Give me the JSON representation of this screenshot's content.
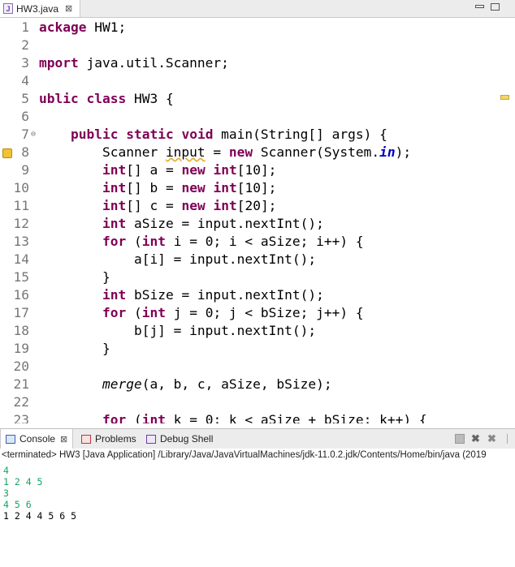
{
  "editor_tab": {
    "title": "HW3.java",
    "close": "⊠"
  },
  "code_lines": [
    {
      "n": "1",
      "tokens": [
        {
          "t": "ackage",
          "c": "kw"
        },
        {
          "t": " HW1;",
          "c": ""
        }
      ]
    },
    {
      "n": "2",
      "tokens": []
    },
    {
      "n": "3",
      "tokens": [
        {
          "t": "mport",
          "c": "kw"
        },
        {
          "t": " java.util.Scanner;",
          "c": ""
        }
      ]
    },
    {
      "n": "4",
      "tokens": []
    },
    {
      "n": "5",
      "tokens": [
        {
          "t": "ublic",
          "c": "kw"
        },
        {
          "t": " ",
          "c": ""
        },
        {
          "t": "class",
          "c": "kw"
        },
        {
          "t": " HW3 {",
          "c": ""
        }
      ]
    },
    {
      "n": "6",
      "tokens": []
    },
    {
      "n": "7",
      "fold": true,
      "tokens": [
        {
          "t": "    ",
          "c": ""
        },
        {
          "t": "public",
          "c": "kw"
        },
        {
          "t": " ",
          "c": ""
        },
        {
          "t": "static",
          "c": "kw"
        },
        {
          "t": " ",
          "c": ""
        },
        {
          "t": "void",
          "c": "kw"
        },
        {
          "t": " main(String[] args) {",
          "c": ""
        }
      ]
    },
    {
      "n": "8",
      "marker": true,
      "tokens": [
        {
          "t": "        Scanner ",
          "c": ""
        },
        {
          "t": "input",
          "c": "warn"
        },
        {
          "t": " = ",
          "c": ""
        },
        {
          "t": "new",
          "c": "kw"
        },
        {
          "t": " Scanner(System.",
          "c": ""
        },
        {
          "t": "in",
          "c": "st"
        },
        {
          "t": ");",
          "c": ""
        }
      ]
    },
    {
      "n": "9",
      "tokens": [
        {
          "t": "        ",
          "c": ""
        },
        {
          "t": "int",
          "c": "kw"
        },
        {
          "t": "[] a = ",
          "c": ""
        },
        {
          "t": "new",
          "c": "kw"
        },
        {
          "t": " ",
          "c": ""
        },
        {
          "t": "int",
          "c": "kw"
        },
        {
          "t": "[10];",
          "c": ""
        }
      ]
    },
    {
      "n": "10",
      "tokens": [
        {
          "t": "        ",
          "c": ""
        },
        {
          "t": "int",
          "c": "kw"
        },
        {
          "t": "[] b = ",
          "c": ""
        },
        {
          "t": "new",
          "c": "kw"
        },
        {
          "t": " ",
          "c": ""
        },
        {
          "t": "int",
          "c": "kw"
        },
        {
          "t": "[10];",
          "c": ""
        }
      ]
    },
    {
      "n": "11",
      "tokens": [
        {
          "t": "        ",
          "c": ""
        },
        {
          "t": "int",
          "c": "kw"
        },
        {
          "t": "[] c = ",
          "c": ""
        },
        {
          "t": "new",
          "c": "kw"
        },
        {
          "t": " ",
          "c": ""
        },
        {
          "t": "int",
          "c": "kw"
        },
        {
          "t": "[20];",
          "c": ""
        }
      ]
    },
    {
      "n": "12",
      "tokens": [
        {
          "t": "        ",
          "c": ""
        },
        {
          "t": "int",
          "c": "kw"
        },
        {
          "t": " aSize = input.nextInt();",
          "c": ""
        }
      ]
    },
    {
      "n": "13",
      "tokens": [
        {
          "t": "        ",
          "c": ""
        },
        {
          "t": "for",
          "c": "kw"
        },
        {
          "t": " (",
          "c": ""
        },
        {
          "t": "int",
          "c": "kw"
        },
        {
          "t": " i = 0; i < aSize; i++) {",
          "c": ""
        }
      ]
    },
    {
      "n": "14",
      "tokens": [
        {
          "t": "            a[i] = input.nextInt();",
          "c": ""
        }
      ]
    },
    {
      "n": "15",
      "tokens": [
        {
          "t": "        }",
          "c": ""
        }
      ]
    },
    {
      "n": "16",
      "tokens": [
        {
          "t": "        ",
          "c": ""
        },
        {
          "t": "int",
          "c": "kw"
        },
        {
          "t": " bSize = input.nextInt();",
          "c": ""
        }
      ]
    },
    {
      "n": "17",
      "tokens": [
        {
          "t": "        ",
          "c": ""
        },
        {
          "t": "for",
          "c": "kw"
        },
        {
          "t": " (",
          "c": ""
        },
        {
          "t": "int",
          "c": "kw"
        },
        {
          "t": " j = 0; j < bSize; j++) {",
          "c": ""
        }
      ]
    },
    {
      "n": "18",
      "tokens": [
        {
          "t": "            b[j] = input.nextInt();",
          "c": ""
        }
      ]
    },
    {
      "n": "19",
      "tokens": [
        {
          "t": "        }",
          "c": ""
        }
      ]
    },
    {
      "n": "20",
      "tokens": []
    },
    {
      "n": "21",
      "tokens": [
        {
          "t": "        ",
          "c": ""
        },
        {
          "t": "merge",
          "c": "it"
        },
        {
          "t": "(a, b, c, aSize, bSize);",
          "c": ""
        }
      ]
    },
    {
      "n": "22",
      "tokens": []
    },
    {
      "n": "23",
      "tokens": [
        {
          "t": "        ",
          "c": ""
        },
        {
          "t": "for",
          "c": "kw"
        },
        {
          "t": " (",
          "c": ""
        },
        {
          "t": "int",
          "c": "kw"
        },
        {
          "t": " k = 0; k < aSize + bSize; k++) {",
          "c": ""
        }
      ]
    }
  ],
  "console": {
    "tabs": {
      "console": "Console",
      "problems": "Problems",
      "debug": "Debug Shell",
      "close": "⊠"
    },
    "terminated": "<terminated> HW3 [Java Application] /Library/Java/JavaVirtualMachines/jdk-11.0.2.jdk/Contents/Home/bin/java (2019",
    "output": [
      {
        "text": "4",
        "kind": "in"
      },
      {
        "text": "1 2 4 5",
        "kind": "in"
      },
      {
        "text": "3",
        "kind": "in"
      },
      {
        "text": "4 5 6",
        "kind": "in"
      },
      {
        "text": "1 2 4 4 5 6 5",
        "kind": "plain"
      }
    ]
  }
}
